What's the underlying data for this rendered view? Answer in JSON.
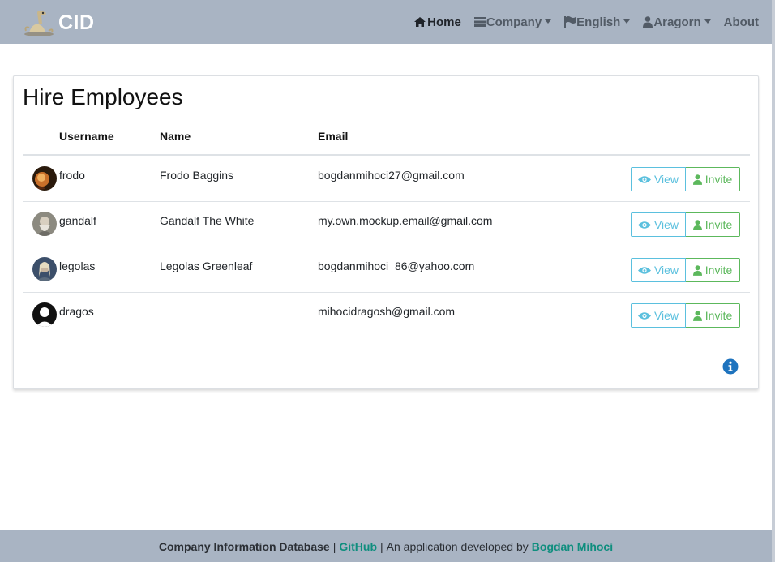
{
  "navbar": {
    "brand": "CID",
    "items": [
      {
        "label": "Home",
        "icon": "home-icon",
        "active": true,
        "dropdown": false
      },
      {
        "label": "Company",
        "icon": "list-icon",
        "active": false,
        "dropdown": true
      },
      {
        "label": "English",
        "icon": "flag-icon",
        "active": false,
        "dropdown": true
      },
      {
        "label": "Aragorn",
        "icon": "user-icon",
        "active": false,
        "dropdown": true
      },
      {
        "label": "About",
        "icon": "",
        "active": false,
        "dropdown": false
      }
    ]
  },
  "card": {
    "title": "Hire Employees",
    "columns": [
      "Username",
      "Name",
      "Email"
    ],
    "rows": [
      {
        "username": "frodo",
        "name": "Frodo Baggins",
        "email": "bogdanmihoci27@gmail.com",
        "avatar": "frodo-avatar"
      },
      {
        "username": "gandalf",
        "name": "Gandalf The White",
        "email": "my.own.mockup.email@gmail.com",
        "avatar": "gandalf-avatar"
      },
      {
        "username": "legolas",
        "name": "Legolas Greenleaf",
        "email": "bogdanmihoci_86@yahoo.com",
        "avatar": "legolas-avatar"
      },
      {
        "username": "dragos",
        "name": "",
        "email": "mihocidragosh@gmail.com",
        "avatar": "default-avatar"
      }
    ],
    "view_label": "View",
    "invite_label": "Invite"
  },
  "footer": {
    "app_name": "Company Information Database",
    "separator": "|",
    "github_link": "GitHub",
    "developed_text": "An application developed by",
    "author_link": "Bogdan Mihoci"
  },
  "colors": {
    "navbar_bg": "#a9b4c3",
    "view_color": "#5bc0de",
    "invite_color": "#5cb85c",
    "info_icon": "#1e73be",
    "footer_link": "#0f8e7e"
  }
}
